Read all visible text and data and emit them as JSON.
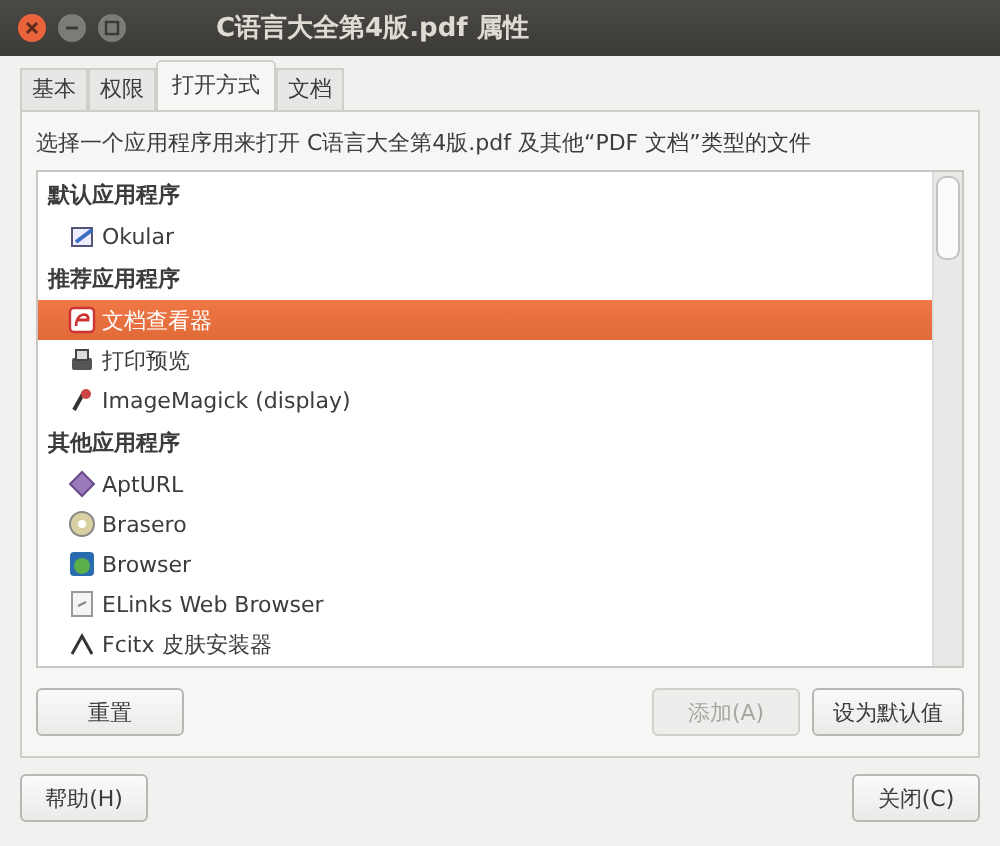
{
  "window": {
    "title": "C语言大全第4版.pdf 属性"
  },
  "tabs": [
    {
      "label": "基本",
      "selected": false
    },
    {
      "label": "权限",
      "selected": false
    },
    {
      "label": "打开方式",
      "selected": true
    },
    {
      "label": "文档",
      "selected": false
    }
  ],
  "description": "选择一个应用程序用来打开 C语言大全第4版.pdf 及其他“PDF 文档”类型的文件",
  "apps": [
    {
      "kind": "header",
      "label": "默认应用程序"
    },
    {
      "kind": "app",
      "label": "Okular",
      "selected": false
    },
    {
      "kind": "header",
      "label": "推荐应用程序"
    },
    {
      "kind": "app",
      "label": "文档查看器",
      "selected": true
    },
    {
      "kind": "app",
      "label": "打印预览",
      "selected": false
    },
    {
      "kind": "app",
      "label": "ImageMagick (display)",
      "selected": false
    },
    {
      "kind": "header",
      "label": "其他应用程序"
    },
    {
      "kind": "app",
      "label": "AptURL",
      "selected": false
    },
    {
      "kind": "app",
      "label": "Brasero",
      "selected": false
    },
    {
      "kind": "app",
      "label": "Browser",
      "selected": false
    },
    {
      "kind": "app",
      "label": "ELinks Web Browser",
      "selected": false
    },
    {
      "kind": "app",
      "label": "Fcitx 皮肤安装器",
      "selected": false
    }
  ],
  "list_buttons": [
    {
      "label": "重置",
      "disabled": false
    },
    {
      "label": "添加(A)",
      "disabled": true
    },
    {
      "label": "设为默认值",
      "disabled": false
    }
  ],
  "dialog_buttons": [
    {
      "label": "帮助(H)"
    },
    {
      "label": "关闭(C)"
    }
  ]
}
